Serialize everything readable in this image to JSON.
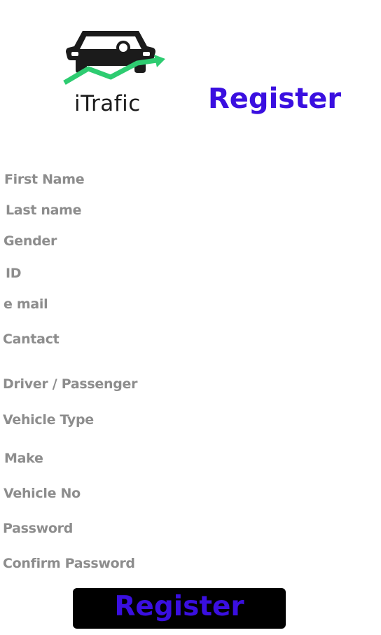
{
  "logo": {
    "text": "iTrafic",
    "icon": "car-with-growth-arrow",
    "arrow_color": "#2ecc71",
    "car_color": "#1b1b1b"
  },
  "header": {
    "title": "Register",
    "title_color": "#3a0fe0"
  },
  "form": {
    "label_color": "#8d8d8d",
    "labels": {
      "first_name": "First Name",
      "last_name": "Last name",
      "gender": "Gender",
      "id": "ID",
      "email": "e mail",
      "contact": "Cantact",
      "driver_passenger": "Driver / Passenger",
      "vehicle_type": "Vehicle Type",
      "make": "Make",
      "vehicle_no": "Vehicle No",
      "password": "Password",
      "confirm_password": "Confirm Password"
    }
  },
  "actions": {
    "register_label": "Register",
    "button_background": "#000000"
  }
}
